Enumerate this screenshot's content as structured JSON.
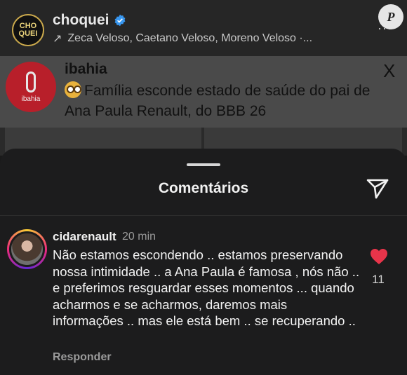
{
  "post": {
    "avatar_text": "CHO QUEI",
    "username": "choquei",
    "audio_text": "Zeca Veloso, Caetano Veloso, Moreno Veloso ·...",
    "more": "···",
    "watermark": "P"
  },
  "embedded_card": {
    "logo_text": "ibahia",
    "source": "ibahia",
    "headline": "Família esconde estado de saúde do pai de Ana Paula Renault, do BBB 26",
    "x_logo": "X"
  },
  "sheet": {
    "title": "Comentários"
  },
  "comment": {
    "username": "cidarenault",
    "time": "20 min",
    "text": "Não estamos escondendo .. estamos preservando nossa intimidade .. a Ana Paula é famosa , nós não .. e preferimos resguardar esses momentos ... quando acharmos e se acharmos, daremos mais informações .. mas ele está bem .. se recuperando ..",
    "reply_label": "Responder",
    "like_count": "11"
  },
  "colors": {
    "like": "#e8344a",
    "verified": "#3897f0",
    "sheet_bg": "#1c1c1d"
  }
}
